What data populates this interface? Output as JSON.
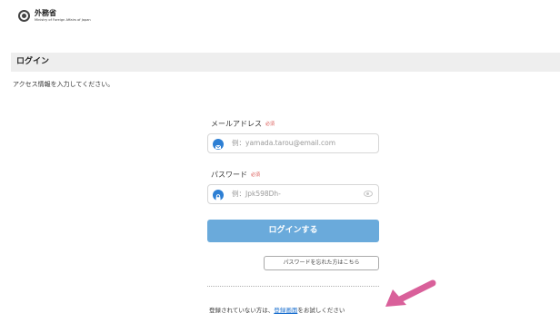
{
  "header": {
    "logo_ja": "外務省",
    "logo_en": "Ministry of Foreign Affairs of Japan"
  },
  "page_title": "ログイン",
  "intro_text": "アクセス情報を入力してください。",
  "form": {
    "email_label": "メールアドレス",
    "email_required": "必須",
    "email_placeholder": "例：yamada.tarou@email.com",
    "password_label": "パスワード",
    "password_required": "必須",
    "password_placeholder": "例：Jpk598Dh-",
    "login_button": "ログインする",
    "forgot_button": "パスワードを忘れた方はこちら"
  },
  "register": {
    "prefix": "登録されていない方は、",
    "link": "登録画面",
    "suffix": "をお試しください"
  },
  "icons": {
    "email": "mail-icon",
    "password": "lock-icon",
    "toggle": "eye-icon",
    "annotation": "arrow-icon"
  },
  "colors": {
    "accent": "#2d7fd4",
    "button": "#6aaadb",
    "required": "#d9534f",
    "annotation_arrow": "#d9609a"
  }
}
